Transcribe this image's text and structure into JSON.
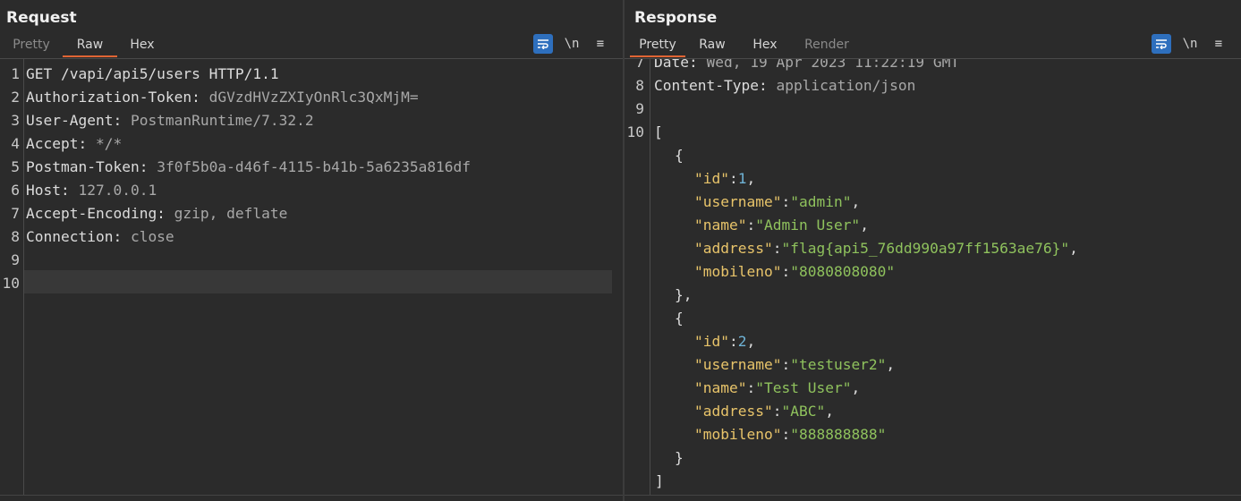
{
  "request": {
    "title": "Request",
    "tabs": [
      "Pretty",
      "Raw",
      "Hex"
    ],
    "active_tab": "Raw",
    "tools": {
      "wrap": "⇆",
      "newline": "\\n",
      "menu": "≡"
    },
    "lines": [
      {
        "num": "1",
        "key": "GET /vapi/api5/users HTTP/1.1",
        "val": ""
      },
      {
        "num": "2",
        "key": "Authorization-Token:",
        "val": " dGVzdHVzZXIyOnRlc3QxMjM="
      },
      {
        "num": "3",
        "key": "User-Agent:",
        "val": " PostmanRuntime/7.32.2"
      },
      {
        "num": "4",
        "key": "Accept:",
        "val": " */*"
      },
      {
        "num": "5",
        "key": "Postman-Token:",
        "val": " 3f0f5b0a-d46f-4115-b41b-5a6235a816df"
      },
      {
        "num": "6",
        "key": "Host:",
        "val": " 127.0.0.1"
      },
      {
        "num": "7",
        "key": "Accept-Encoding:",
        "val": " gzip, deflate"
      },
      {
        "num": "8",
        "key": "Connection:",
        "val": " close"
      },
      {
        "num": "9",
        "key": "",
        "val": ""
      },
      {
        "num": "10",
        "key": "",
        "val": ""
      }
    ]
  },
  "response": {
    "title": "Response",
    "tabs": [
      "Pretty",
      "Raw",
      "Hex",
      "Render"
    ],
    "active_tab": "Pretty",
    "tools": {
      "wrap": "⇆",
      "newline": "\\n",
      "menu": "≡"
    },
    "header_lines": [
      {
        "num": "7",
        "key": "Date:",
        "val": " Wed, 19 Apr 2023 11:22:19 GMT"
      },
      {
        "num": "8",
        "key": "Content-Type:",
        "val": " application/json"
      },
      {
        "num": "9",
        "key": "",
        "val": ""
      },
      {
        "num": "10",
        "key": "[",
        "val": ""
      }
    ],
    "json_lines": [
      {
        "indent": 1,
        "p": "{"
      },
      {
        "indent": 2,
        "k": "\"id\"",
        "c": ":",
        "n": "1",
        "e": ","
      },
      {
        "indent": 2,
        "k": "\"username\"",
        "c": ":",
        "s": "\"admin\"",
        "e": ","
      },
      {
        "indent": 2,
        "k": "\"name\"",
        "c": ":",
        "s": "\"Admin User\"",
        "e": ","
      },
      {
        "indent": 2,
        "k": "\"address\"",
        "c": ":",
        "s": "\"flag{api5_76dd990a97ff1563ae76}\"",
        "e": ","
      },
      {
        "indent": 2,
        "k": "\"mobileno\"",
        "c": ":",
        "s": "\"8080808080\"",
        "e": ""
      },
      {
        "indent": 1,
        "p": "},"
      },
      {
        "indent": 1,
        "p": "{"
      },
      {
        "indent": 2,
        "k": "\"id\"",
        "c": ":",
        "n": "2",
        "e": ","
      },
      {
        "indent": 2,
        "k": "\"username\"",
        "c": ":",
        "s": "\"testuser2\"",
        "e": ","
      },
      {
        "indent": 2,
        "k": "\"name\"",
        "c": ":",
        "s": "\"Test User\"",
        "e": ","
      },
      {
        "indent": 2,
        "k": "\"address\"",
        "c": ":",
        "s": "\"ABC\"",
        "e": ","
      },
      {
        "indent": 2,
        "k": "\"mobileno\"",
        "c": ":",
        "s": "\"888888888\"",
        "e": ""
      },
      {
        "indent": 1,
        "p": "}"
      },
      {
        "indent": 0,
        "p": "]"
      }
    ]
  },
  "colors": {
    "accent": "#e06434",
    "toggle_on": "#2e6fbd",
    "json_key": "#e8c46a",
    "json_string": "#8fc25d",
    "json_number": "#6fb3d6"
  }
}
